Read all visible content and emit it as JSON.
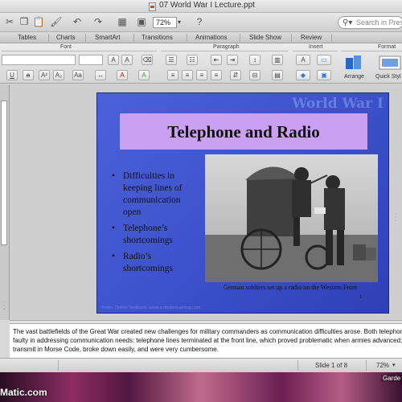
{
  "window": {
    "title": "07 World War I Lecture.ppt"
  },
  "toolbar": {
    "zoom": "72%",
    "search_placeholder": "Search in Pres"
  },
  "ribbon": {
    "tabs": [
      "Tables",
      "Charts",
      "SmartArt",
      "Transitions",
      "Animations",
      "Slide Show",
      "Review"
    ],
    "groups": {
      "font": "Font",
      "paragraph": "Paragraph",
      "insert": "Insert",
      "format": "Format"
    },
    "arrange_label": "Arrange",
    "quick_styles_label": "Quick Styl"
  },
  "slide": {
    "watermark": "World War I",
    "title": "Telephone and Radio",
    "bullets": [
      "Difficulties in keeping lines of communication open",
      "Telephone’s shortcomings",
      "Radio’s shortcomings"
    ],
    "caption": "German soldiers set up a radio on the Western Front",
    "number": "1",
    "footer": "From: Online Textbook, www.unitedstreaming.com"
  },
  "notes": {
    "text": "The vast battlefields of the Great War created new challenges for military commanders as communication difficulties arose. Both telephone and radio proved faulty in addressing communication needs: telephone lines terminated at the front line, which proved problematic when armies advanced; radios could only transmit in Morse Code, broke down easily, and were very cumbersome."
  },
  "status": {
    "slide_indicator": "Slide 1 of 8",
    "zoom": "72%"
  },
  "desktop": {
    "watermark": "Matic.com",
    "dock_label": "Garde"
  },
  "colors": {
    "slide_background": "#3d52cc",
    "title_box": "#c9a0f3"
  }
}
